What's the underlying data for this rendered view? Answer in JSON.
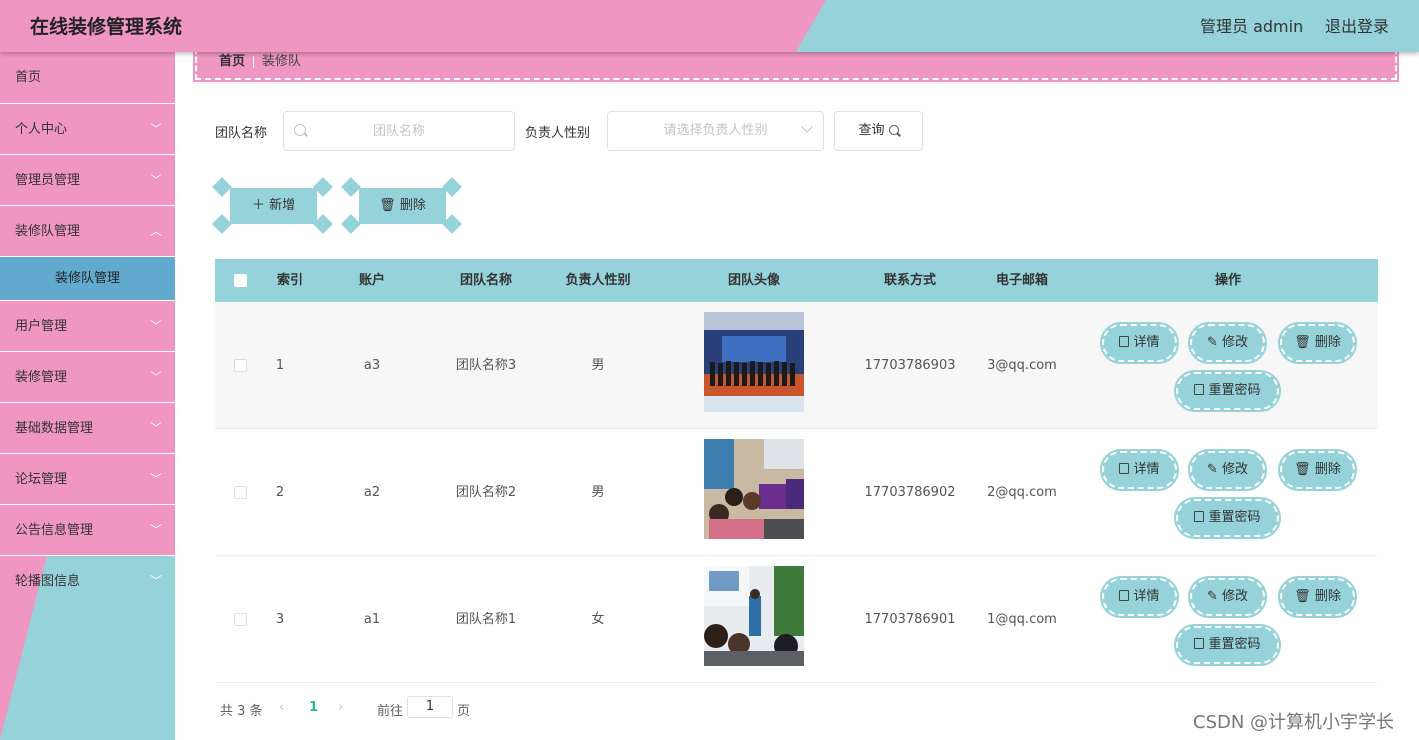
{
  "header": {
    "title": "在线装修管理系统",
    "user": "管理员 admin",
    "logout": "退出登录"
  },
  "sidebar": {
    "items": [
      {
        "label": "首页"
      },
      {
        "label": "个人中心"
      },
      {
        "label": "管理员管理"
      },
      {
        "label": "装修队管理"
      },
      {
        "label": "装修队管理"
      },
      {
        "label": "用户管理"
      },
      {
        "label": "装修管理"
      },
      {
        "label": "基础数据管理"
      },
      {
        "label": "论坛管理"
      },
      {
        "label": "公告信息管理"
      },
      {
        "label": "轮播图信息"
      }
    ]
  },
  "breadcrumb": {
    "home": "首页",
    "current": "装修队"
  },
  "search": {
    "team_name_label": "团队名称",
    "team_name_placeholder": "团队名称",
    "gender_label": "负责人性别",
    "gender_placeholder": "请选择负责人性别",
    "query_label": "查询"
  },
  "actions": {
    "add_label": "新增",
    "delete_label": "删除"
  },
  "table": {
    "headers": [
      "索引",
      "账户",
      "团队名称",
      "负责人性别",
      "团队头像",
      "联系方式",
      "电子邮箱",
      "操作"
    ],
    "rows": [
      {
        "index": "1",
        "account": "a3",
        "team": "团队名称3",
        "gender": "男",
        "phone": "17703786903",
        "email": "3@qq.com"
      },
      {
        "index": "2",
        "account": "a2",
        "team": "团队名称2",
        "gender": "男",
        "phone": "17703786902",
        "email": "2@qq.com"
      },
      {
        "index": "3",
        "account": "a1",
        "team": "团队名称1",
        "gender": "女",
        "phone": "17703786901",
        "email": "1@qq.com"
      }
    ],
    "ops": {
      "detail": "详情",
      "edit": "修改",
      "delete": "删除",
      "reset": "重置密码"
    }
  },
  "pagination": {
    "total": "共 3 条",
    "page": "1",
    "goto": "前往",
    "goto_value": "1",
    "unit": "页"
  },
  "watermark": "CSDN @计算机小宇学长",
  "colors": {
    "pink": "#f096c3",
    "teal": "#96d2d9",
    "active_sub": "#62a9cf",
    "page_green": "#2ab39d"
  }
}
